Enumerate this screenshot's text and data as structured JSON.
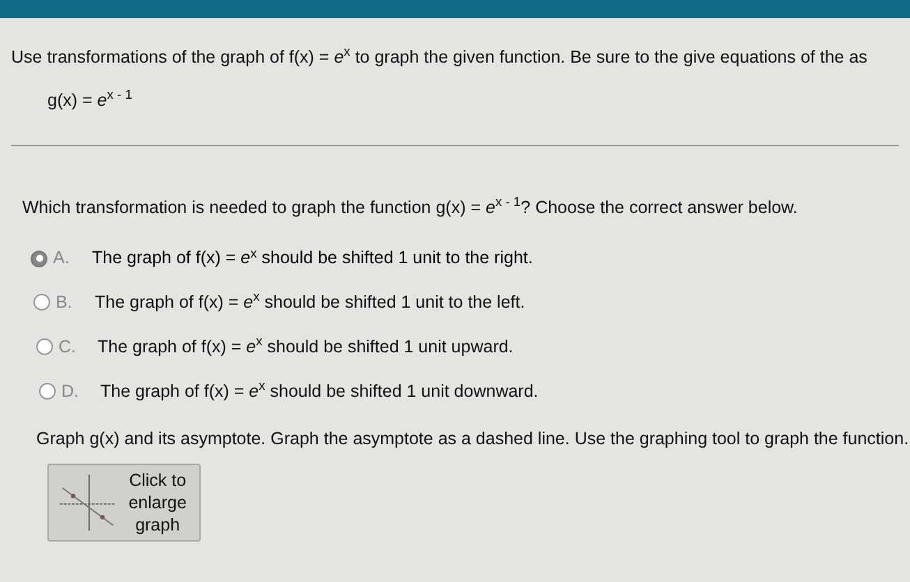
{
  "instruction": "Use transformations of the graph of f(x) = *e*$^{x}$ to graph the given function. Be sure to the give equations of the as",
  "function": "g(x) = *e*$^{x - 1}$",
  "question": "Which transformation is needed to graph the function g(x) = *e*$^{x - 1}$? Choose the correct answer below.",
  "options": [
    {
      "letter": "A.",
      "text": "The graph of f(x) = *e*$^{x}$ should be shifted 1 unit to the right.",
      "selected": true
    },
    {
      "letter": "B.",
      "text": "The graph of f(x) = *e*$^{x}$ should be shifted 1 unit to the left.",
      "selected": false
    },
    {
      "letter": "C.",
      "text": "The graph of f(x) = *e*$^{x}$ should be shifted 1 unit upward.",
      "selected": false
    },
    {
      "letter": "D.",
      "text": "The graph of f(x) = *e*$^{x}$ should be shifted 1 unit downward.",
      "selected": false
    }
  ],
  "graph_instruction": "Graph g(x) and its asymptote. Graph the asymptote as a dashed line. Use the graphing tool to graph the function.",
  "enlarge_button": "Click to enlarge graph"
}
